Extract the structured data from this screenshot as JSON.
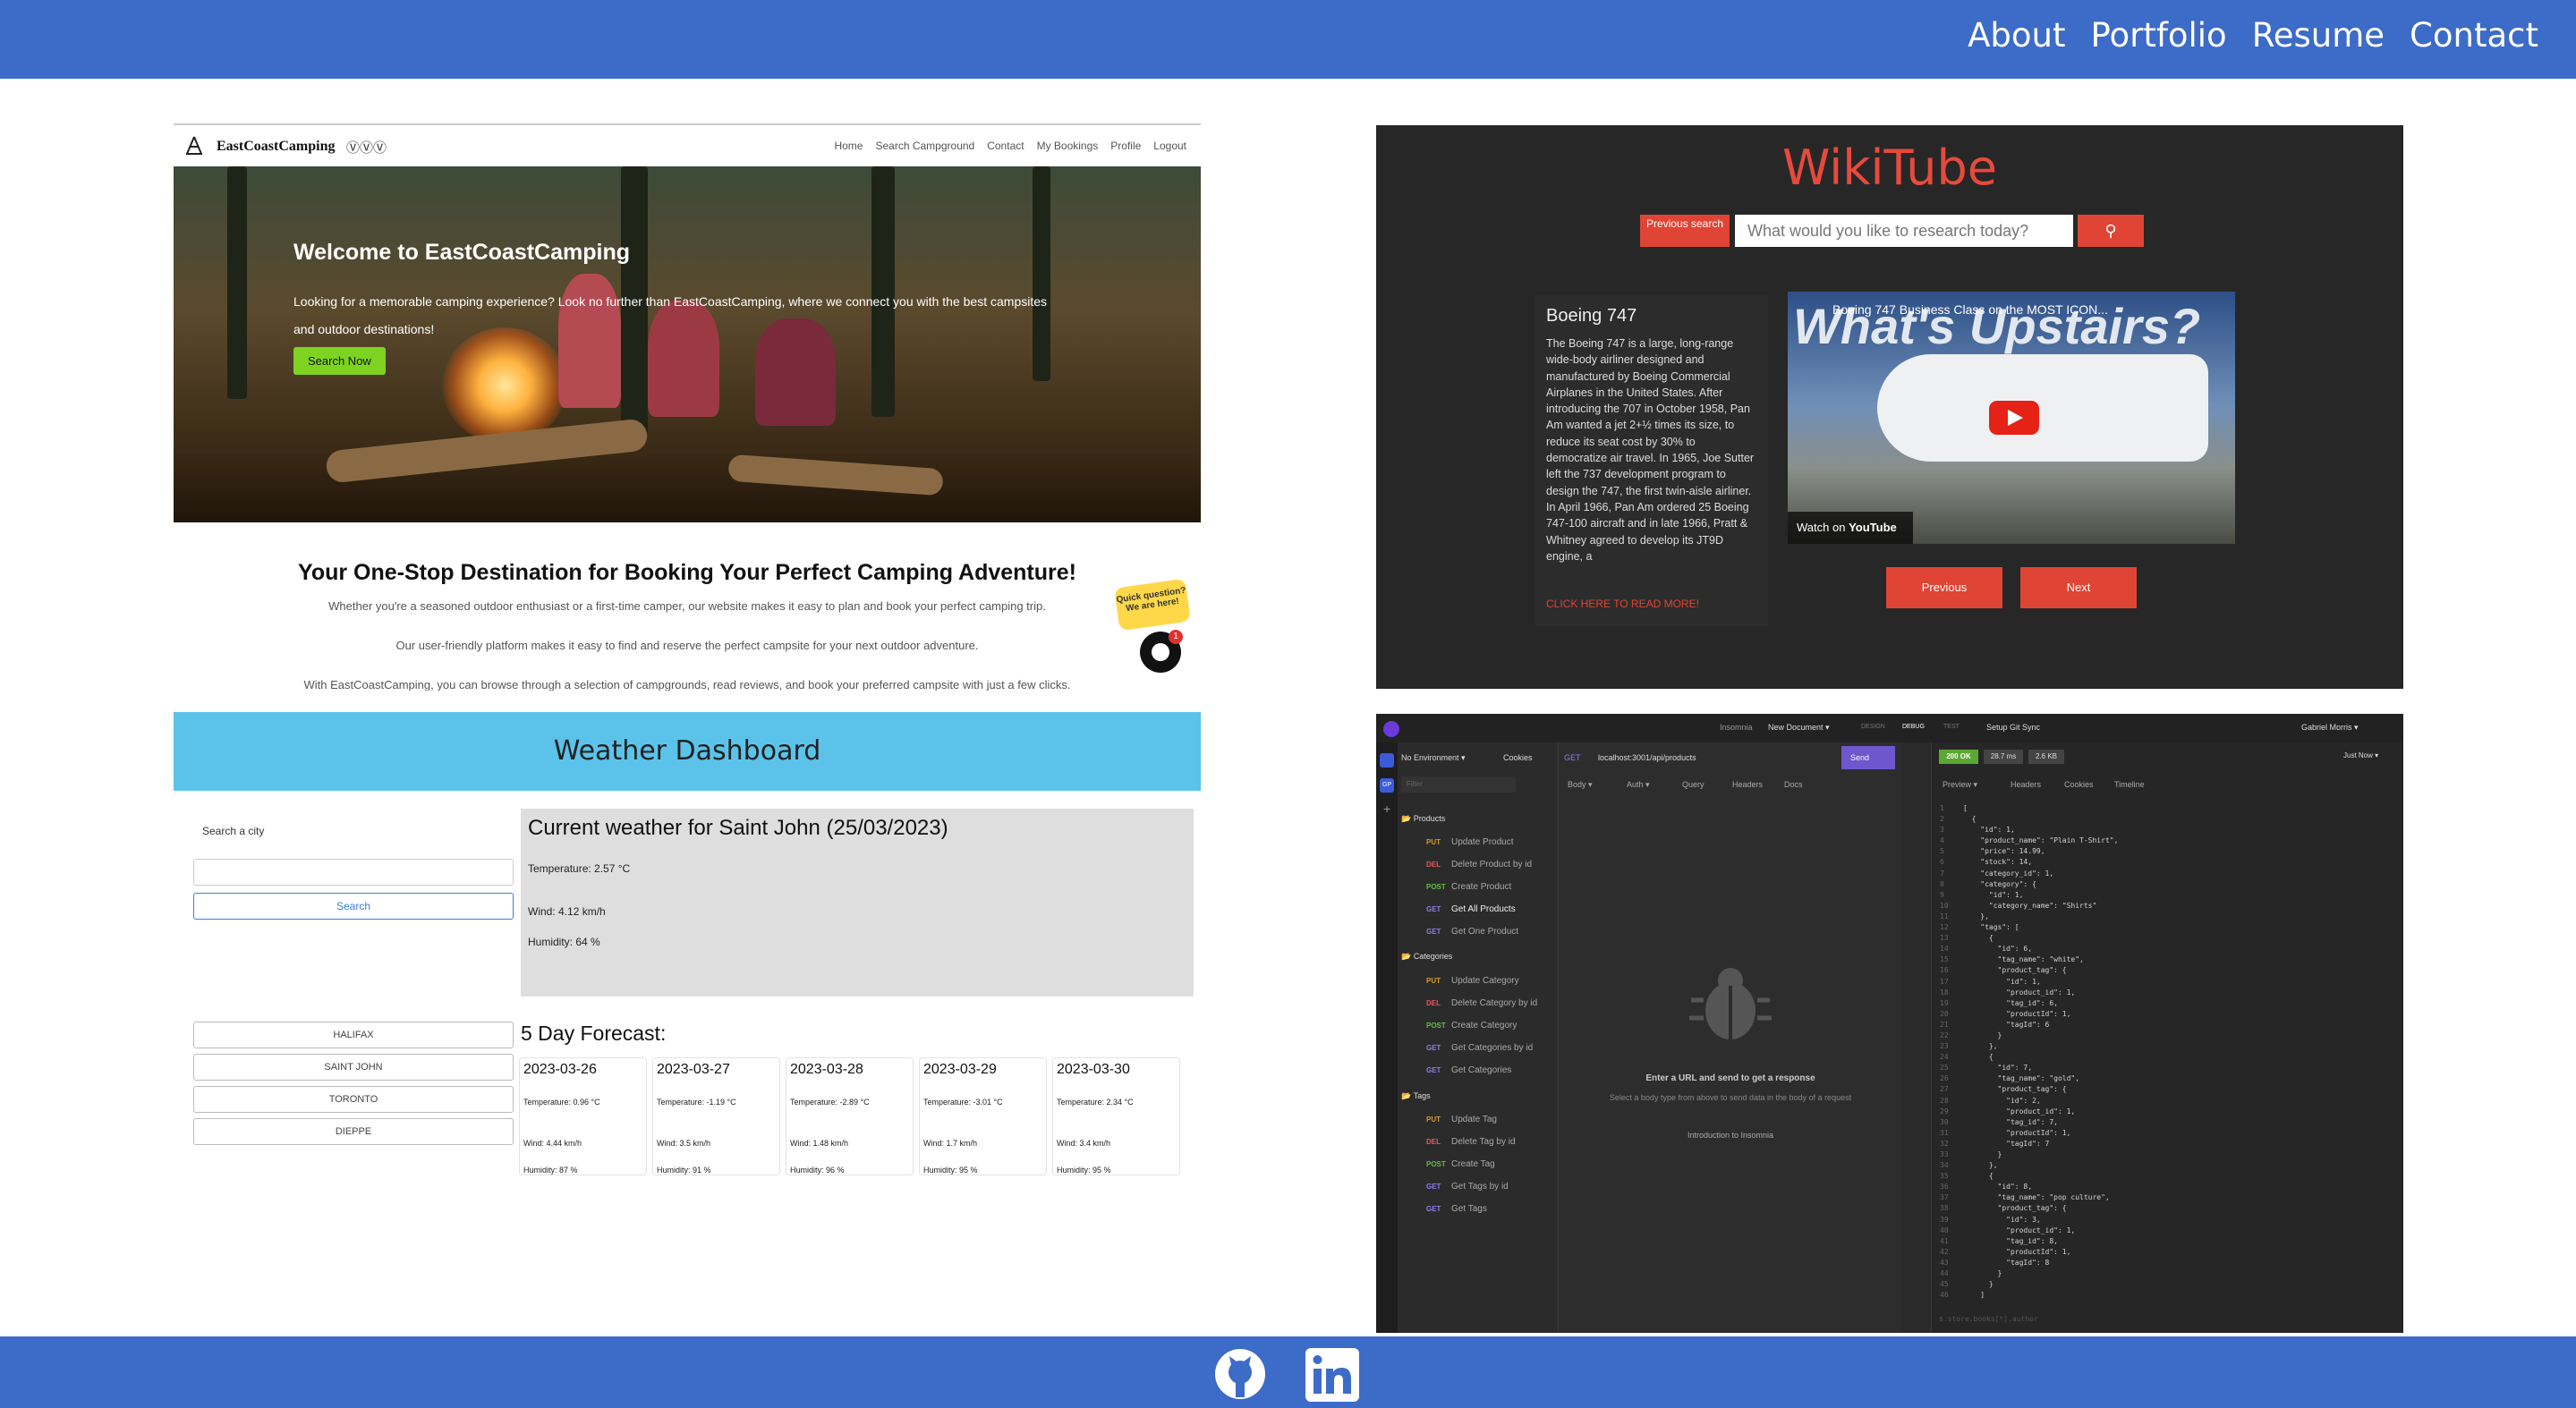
{
  "nav": {
    "links": [
      "About",
      "Portfolio",
      "Resume",
      "Contact"
    ]
  },
  "camping": {
    "brand": "EastCoastCamping",
    "brand_icons": "ⓋⓋⓋ",
    "menu": [
      "Home",
      "Search Campground",
      "Contact",
      "My Bookings",
      "Profile",
      "Logout"
    ],
    "hero_title": "Welcome to EastCoastCamping",
    "hero_text": "Looking for a memorable camping experience? Look no further than EastCoastCamping, where we connect you with the best campsites and outdoor destinations!",
    "hero_button": "Search Now",
    "tagline": "Your One-Stop Destination for Booking Your Perfect Camping Adventure!",
    "p1": "Whether you're a seasoned outdoor enthusiast or a first-time camper, our website makes it easy to plan and book your perfect camping trip.",
    "p2": "Our user-friendly platform makes it easy to find and reserve the perfect campsite for your next outdoor adventure.",
    "p3": "With EastCoastCamping, you can browse through a selection of campgrounds, read reviews, and book your preferred campsite with just a few clicks.",
    "chat_bubble": "Quick question? We are here!",
    "chat_badge": "1"
  },
  "wikitube": {
    "logo": "WikiTube",
    "prev_search": "Previous search",
    "search_placeholder": "What would you like to research today?",
    "article_title": "Boeing 747",
    "article_text": "The Boeing 747 is a large, long-range wide-body airliner designed and manufactured by Boeing Commercial Airplanes in the United States. After introducing the 707 in October 1958, Pan Am wanted a jet 2+½ times its size, to reduce its seat cost by 30% to democratize air travel. In 1965, Joe Sutter left the 737 development program to design the 747, the first twin-aisle airliner. In April 1966, Pan Am ordered 25 Boeing 747-100 aircraft and in late 1966, Pratt & Whitney agreed to develop its JT9D engine, a",
    "read_more": "CLICK HERE TO READ MORE!",
    "video_title": "Boeing 747 Business Class on the MOST ICON...",
    "video_overlay": "What's Upstairs?",
    "watch_on": "Watch on",
    "youtube": "YouTube",
    "previous": "Previous",
    "next": "Next"
  },
  "weather": {
    "title": "Weather Dashboard",
    "search_label": "Search a city",
    "search_button": "Search",
    "cities": [
      "HALIFAX",
      "SAINT JOHN",
      "TORONTO",
      "DIEPPE"
    ],
    "current_title": "Current weather for Saint John (25/03/2023)",
    "current_temp": "Temperature: 2.57 °C",
    "current_wind": "Wind: 4.12 km/h",
    "current_humidity": "Humidity: 64 %",
    "forecast_title": "5 Day Forecast:",
    "forecast": [
      {
        "date": "2023-03-26",
        "temp": "Temperature: 0.96 °C",
        "wind": "Wind: 4.44 km/h",
        "humidity": "Humidity: 87 %"
      },
      {
        "date": "2023-03-27",
        "temp": "Temperature: -1.19 °C",
        "wind": "Wind: 3.5 km/h",
        "humidity": "Humidity: 91 %"
      },
      {
        "date": "2023-03-28",
        "temp": "Temperature: -2.89 °C",
        "wind": "Wind: 1.48 km/h",
        "humidity": "Humidity: 96 %"
      },
      {
        "date": "2023-03-29",
        "temp": "Temperature: -3.01 °C",
        "wind": "Wind: 1.7 km/h",
        "humidity": "Humidity: 95 %"
      },
      {
        "date": "2023-03-30",
        "temp": "Temperature: 2.34 °C",
        "wind": "Wind: 3.4 km/h",
        "humidity": "Humidity: 95 %"
      }
    ]
  },
  "insomnia": {
    "app": "Insomnia",
    "doc": "New Document ▾",
    "tabs": [
      "DESIGN",
      "DEBUG",
      "TEST"
    ],
    "git": "Setup Git Sync",
    "user": "Gabriel Morris ▾",
    "env": "No Environment ▾",
    "cookies": "Cookies",
    "filter": "Filter",
    "method": "GET",
    "url": "localhost:3001/api/products",
    "send": "Send",
    "status": "200 OK",
    "time": "28.7 ms",
    "size": "2.6 KB",
    "just_now": "Just Now ▾",
    "req_tabs": [
      "Body ▾",
      "Auth ▾",
      "Query",
      "Headers",
      "Docs"
    ],
    "resp_tabs": [
      "Preview ▾",
      "Headers",
      "Cookies",
      "Timeline"
    ],
    "folders": [
      {
        "name": "Products",
        "items": [
          [
            "PUT",
            "Update Product"
          ],
          [
            "DEL",
            "Delete Product by id"
          ],
          [
            "POST",
            "Create Product"
          ],
          [
            "GET",
            "Get All Products"
          ],
          [
            "GET",
            "Get One Product"
          ]
        ]
      },
      {
        "name": "Categories",
        "items": [
          [
            "PUT",
            "Update Category"
          ],
          [
            "DEL",
            "Delete Category by id"
          ],
          [
            "POST",
            "Create Category"
          ],
          [
            "GET",
            "Get Categories by id"
          ],
          [
            "GET",
            "Get Categories"
          ]
        ]
      },
      {
        "name": "Tags",
        "items": [
          [
            "PUT",
            "Update Tag"
          ],
          [
            "DEL",
            "Delete Tag by id"
          ],
          [
            "POST",
            "Create Tag"
          ],
          [
            "GET",
            "Get Tags by id"
          ],
          [
            "GET",
            "Get Tags"
          ]
        ]
      }
    ],
    "empty_title": "Enter a URL and send to get a response",
    "empty_sub": "Select a body type from above to send data in the body of a request",
    "intro": "Introduction to Insomnia",
    "filter_hint": "$.store.books[*].author",
    "code": "[\n  {\n    \"id\": 1,\n    \"product_name\": \"Plain T-Shirt\",\n    \"price\": 14.99,\n    \"stock\": 14,\n    \"category_id\": 1,\n    \"category\": {\n      \"id\": 1,\n      \"category_name\": \"Shirts\"\n    },\n    \"tags\": [\n      {\n        \"id\": 6,\n        \"tag_name\": \"white\",\n        \"product_tag\": {\n          \"id\": 1,\n          \"product_id\": 1,\n          \"tag_id\": 6,\n          \"productId\": 1,\n          \"tagId\": 6\n        }\n      },\n      {\n        \"id\": 7,\n        \"tag_name\": \"gold\",\n        \"product_tag\": {\n          \"id\": 2,\n          \"product_id\": 1,\n          \"tag_id\": 7,\n          \"productId\": 1,\n          \"tagId\": 7\n        }\n      },\n      {\n        \"id\": 8,\n        \"tag_name\": \"pop culture\",\n        \"product_tag\": {\n          \"id\": 3,\n          \"product_id\": 1,\n          \"tag_id\": 8,\n          \"productId\": 1,\n          \"tagId\": 8\n        }\n      }\n    ]"
  },
  "footer": {
    "icons": [
      "github-icon",
      "linkedin-icon"
    ]
  }
}
